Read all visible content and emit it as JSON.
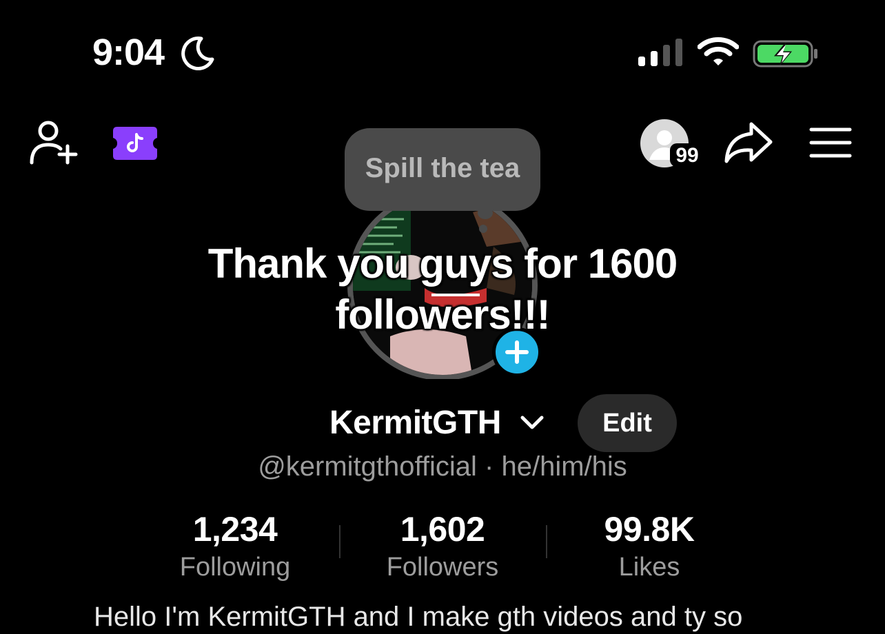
{
  "status_bar": {
    "time": "9:04",
    "moon_icon": "moon-icon",
    "signal_icon": "cellular-signal-icon",
    "wifi_icon": "wifi-icon",
    "battery_icon": "battery-charging-icon",
    "battery_color": "#4cd964"
  },
  "top_nav": {
    "add_friend_icon": "add-friend-icon",
    "ticket_icon": "tiktok-ticket-icon",
    "ticket_color": "#8a3ffc",
    "profile_views_badge": "99",
    "share_icon": "share-icon",
    "menu_icon": "menu-icon"
  },
  "note": {
    "text": "Spill the tea"
  },
  "overlay_caption": {
    "line1": "Thank you guys for 1600",
    "line2": "followers!!!"
  },
  "profile": {
    "display_name": "KermitGTH",
    "edit_label": "Edit",
    "handle": "@kermitgthofficial · he/him/his",
    "add_story_color": "#1fb3e6"
  },
  "stats": [
    {
      "value": "1,234",
      "label": "Following"
    },
    {
      "value": "1,602",
      "label": "Followers"
    },
    {
      "value": "99.8K",
      "label": "Likes"
    }
  ],
  "bio": {
    "text": "Hello I'm KermitGTH and I make gth videos and ty so"
  }
}
